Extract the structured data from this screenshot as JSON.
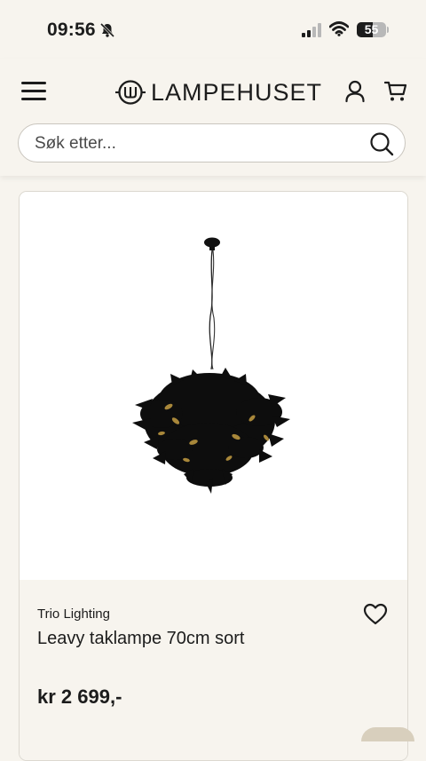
{
  "status_bar": {
    "time": "09:56",
    "battery": "55",
    "battery_level": 0.55,
    "icons": [
      "bell-off-icon",
      "signal-icon",
      "wifi-icon",
      "battery-icon"
    ]
  },
  "header": {
    "brand": "LAMPEHUSET",
    "icons": [
      "menu-icon",
      "logo-icon",
      "account-icon",
      "cart-icon"
    ]
  },
  "search": {
    "placeholder": "Søk etter...",
    "value": ""
  },
  "product": {
    "brand": "Trio Lighting",
    "title": "Leavy taklampe 70cm sort",
    "price": "kr 2 699,-",
    "wishlist_icon": "heart-outline-icon"
  },
  "colors": {
    "background": "#f7f4ee",
    "text": "#1c1c1c",
    "card_border": "#dcd8d0",
    "accent_gold": "#a8873a"
  }
}
